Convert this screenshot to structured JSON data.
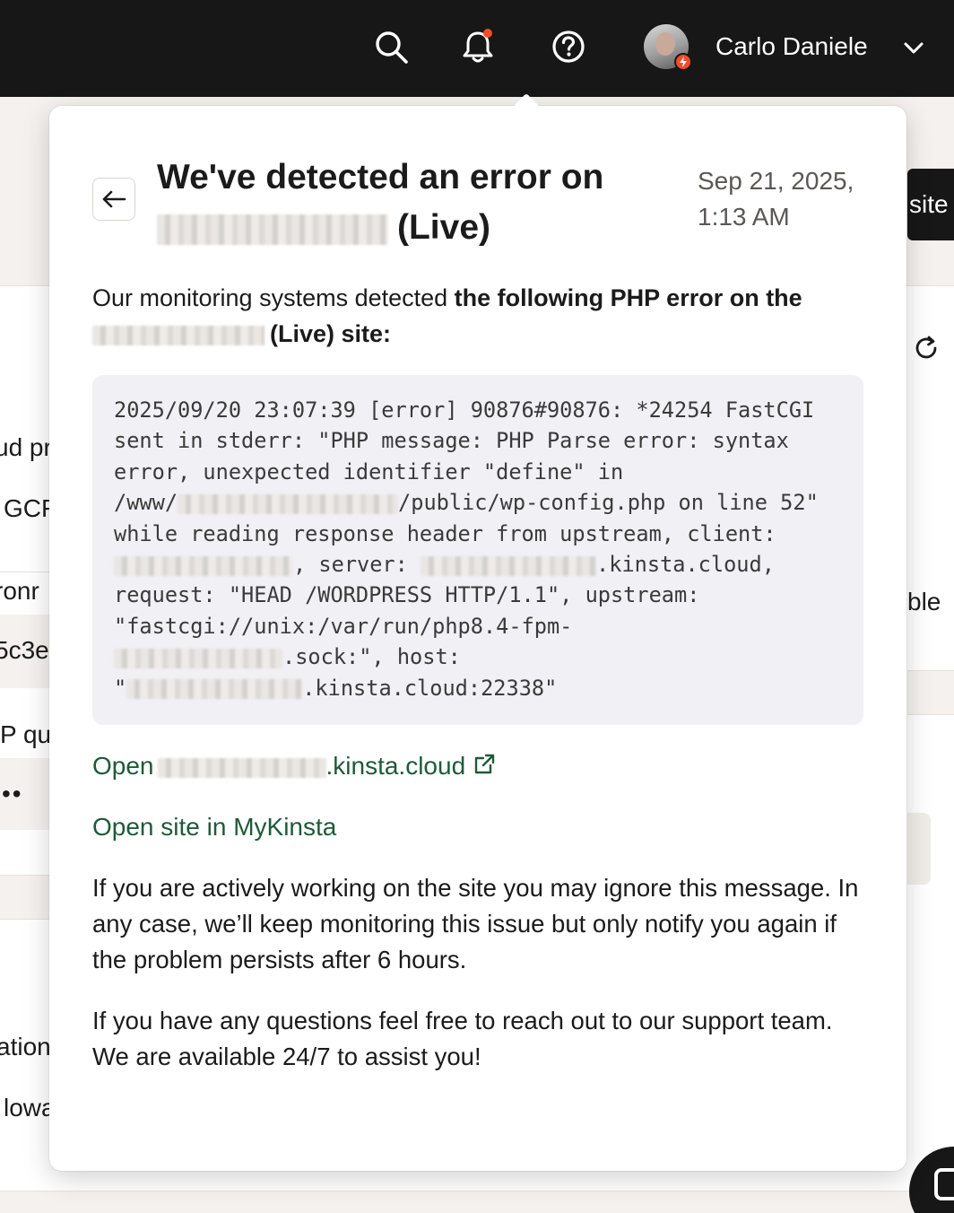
{
  "topbar": {
    "search_icon": "search-icon",
    "notifications_icon": "bell-icon",
    "help_icon": "question-circle-icon",
    "user_name": "Carlo Daniele",
    "accent_color": "#ee4e2a"
  },
  "background_page": {
    "right_button_label": "site",
    "left_fragments": [
      "ud pr",
      "GCF",
      "ronr",
      "5c3e",
      "P qu",
      "ation",
      "lowa"
    ],
    "right_fragment": "ble",
    "dots": "••"
  },
  "notification": {
    "title_line1": "We've detected an error on",
    "title_suffix": "(Live)",
    "date_line1": "Sep 21, 2025,",
    "date_line2": "1:13 AM",
    "intro_plain": "Our monitoring systems detected ",
    "intro_bold": "the following PHP error on the",
    "intro_bold_suffix": "(Live) site:",
    "log": {
      "line1": "2025/09/20 23:07:39 [error] 90876#90876: *24254 FastCGI",
      "line2": "sent in stderr: \"PHP message: PHP Parse error: syntax",
      "line3": "error, unexpected identifier \"define\" in",
      "line4_prefix": "/www/",
      "line4_suffix": "/public/wp-config.php on line 52\"",
      "line5": "while reading response header from upstream, client:",
      "line6_mid": ", server: ",
      "line6_suffix": ".kinsta.cloud,",
      "line7": "request: \"HEAD /WORDPRESS HTTP/1.1\", upstream:",
      "line8": "\"fastcgi://unix:/var/run/php8.4-fpm-",
      "line9_suffix": ".sock:\", host:",
      "line10_prefix": "\"",
      "line10_suffix": ".kinsta.cloud:22338\""
    },
    "open_link_prefix": "Open",
    "open_link_suffix": ".kinsta.cloud",
    "open_mykinsta": "Open site in MyKinsta",
    "link_color": "#1d5b39",
    "paragraph1": "If you are actively working on the site you may ignore this message. In any case, we’ll keep monitoring this issue but only notify you again if the problem persists after 6 hours.",
    "paragraph2": "If you have any questions feel free to reach out to our support team. We are available 24/7 to assist you!"
  }
}
